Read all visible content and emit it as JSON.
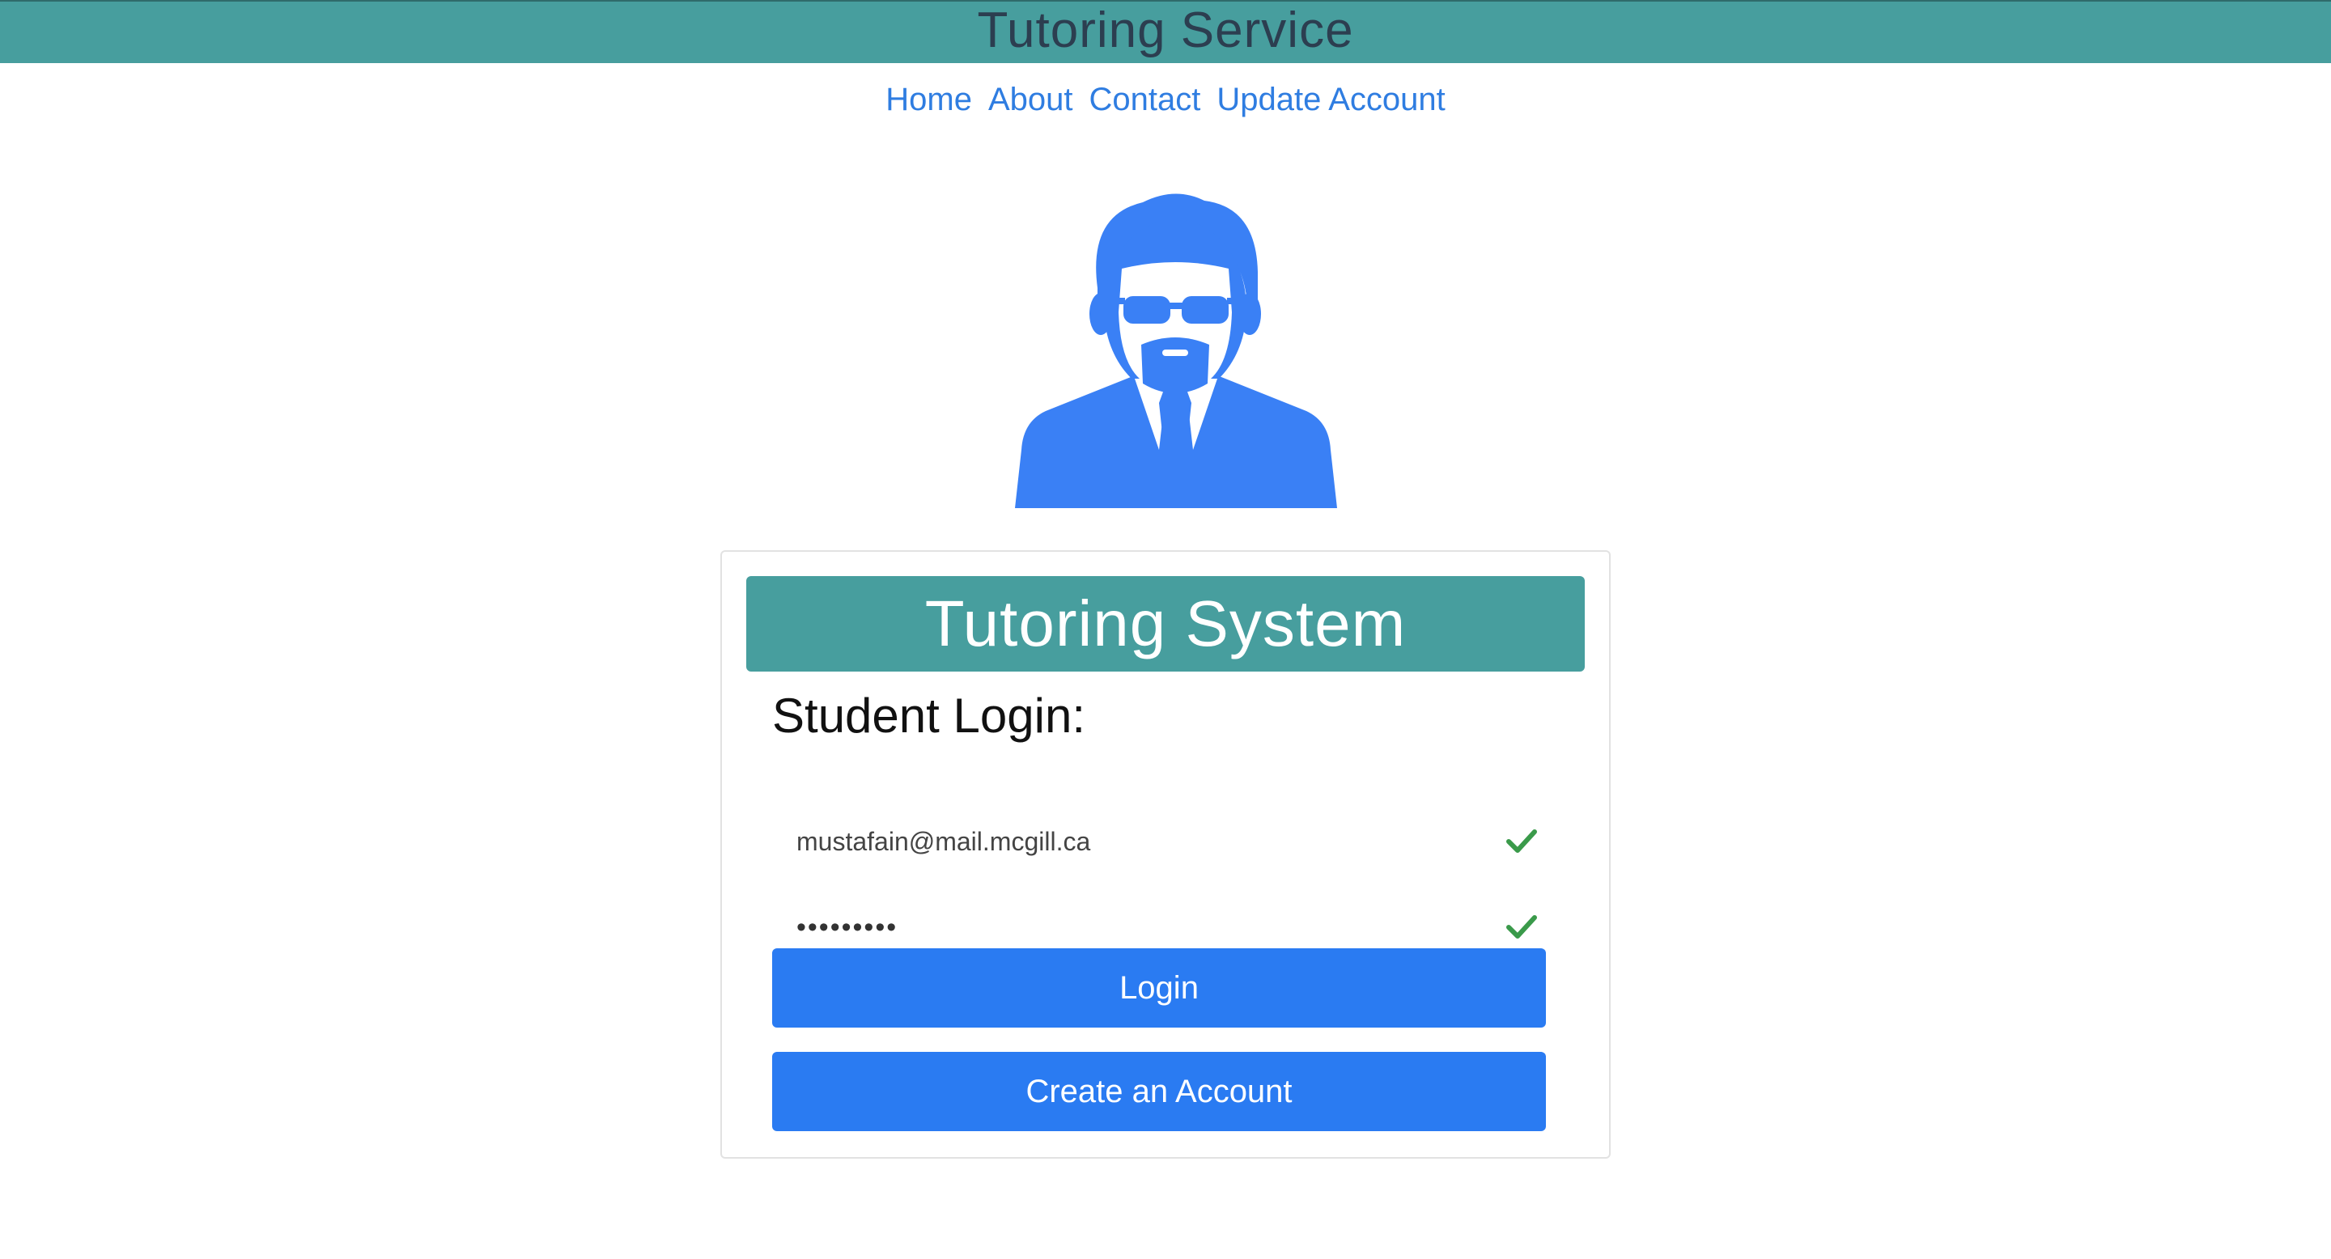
{
  "header": {
    "title": "Tutoring Service"
  },
  "nav": {
    "items": [
      {
        "label": "Home"
      },
      {
        "label": "About"
      },
      {
        "label": "Contact"
      },
      {
        "label": "Update Account"
      }
    ]
  },
  "avatar": {
    "icon": "user-avatar-icon",
    "color": "#3a80f5"
  },
  "card": {
    "header_title": "Tutoring System",
    "login_label": "Student Login:",
    "email_value": "mustafain@mail.mcgill.ca",
    "password_value": "•••••••••",
    "login_button": "Login",
    "create_button": "Create an Account"
  },
  "colors": {
    "teal": "#479e9e",
    "primary": "#2a7bf2",
    "valid_check": "#3a9a4a",
    "link": "#2f7de1"
  }
}
